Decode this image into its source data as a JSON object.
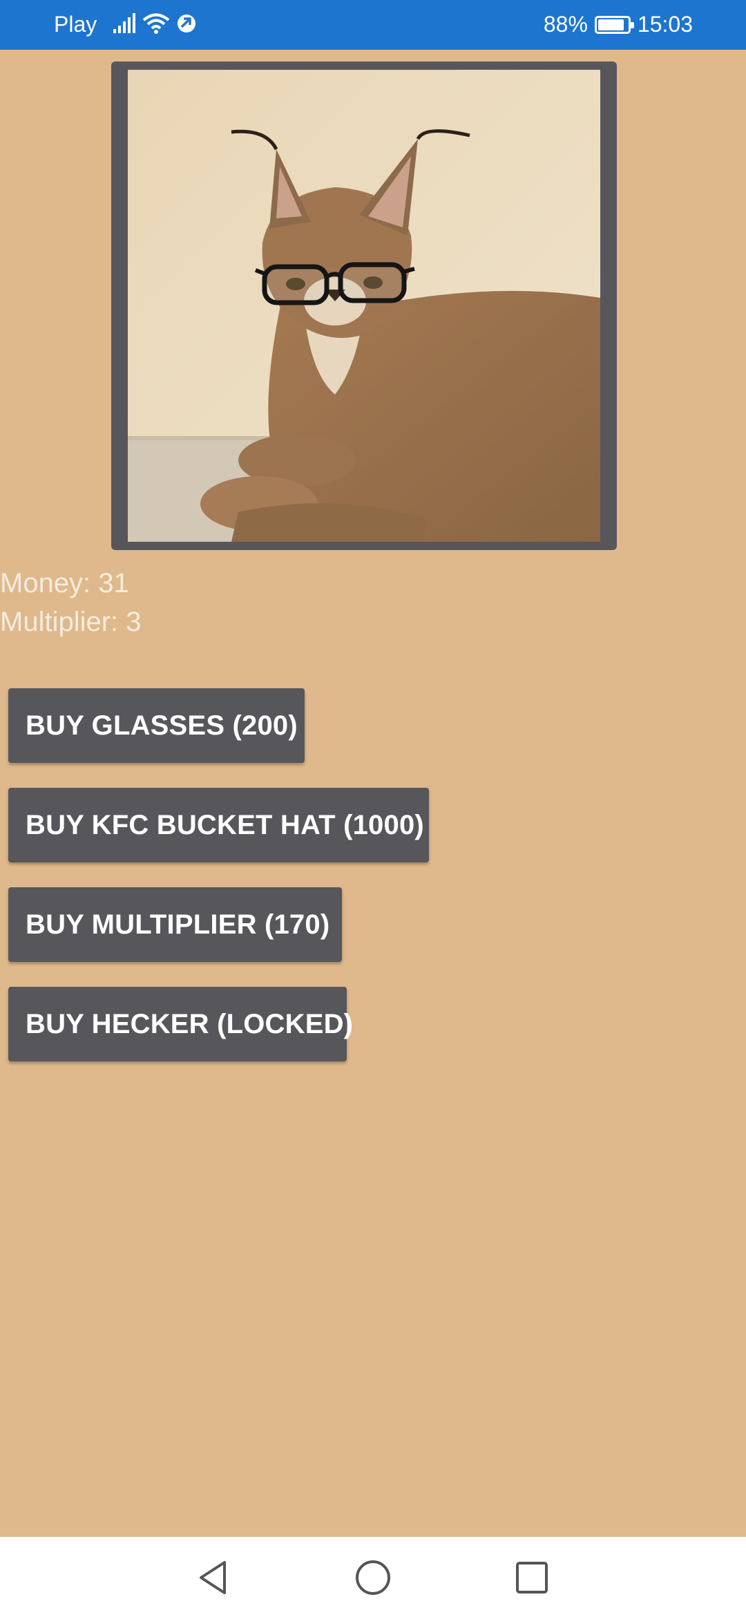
{
  "status_bar": {
    "carrier": "Play",
    "battery_percent_text": "88%",
    "battery_level": 0.88,
    "time": "15:03",
    "icons": [
      "signal-icon",
      "wifi-icon",
      "data-saver-icon",
      "battery-icon"
    ]
  },
  "game": {
    "image_alt": "caracal-with-glasses",
    "money_text": "Money: 31",
    "multiplier_text": "Multiplier: 3"
  },
  "buttons": [
    {
      "label": "BUY GLASSES (200)"
    },
    {
      "label": "BUY KFC BUCKET HAT (1000)"
    },
    {
      "label": "BUY MULTIPLIER (170)"
    },
    {
      "label": "BUY HECKER (LOCKED)"
    }
  ],
  "nav_bar": {
    "icons": [
      "back-icon",
      "home-icon",
      "recents-icon"
    ]
  },
  "colors": {
    "status_bar": "#1e75cf",
    "background": "#dfb98b",
    "button": "#57575b",
    "frame": "#57575b",
    "nav_bar": "#ffffff"
  }
}
